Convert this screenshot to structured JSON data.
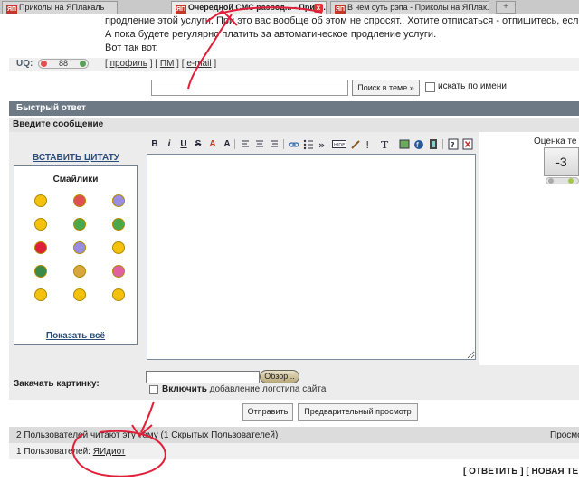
{
  "browser": {
    "tabs": [
      {
        "label": "Приколы на ЯПлакаль",
        "active": false,
        "favicon": "ЯП"
      },
      {
        "label": "Очередной СМС развод... - Прик...",
        "active": true,
        "favicon": "ЯП"
      },
      {
        "label": "В чем суть рэпа - Приколы на ЯПлак...",
        "active": false,
        "favicon": "ЯП"
      }
    ],
    "newtab_label": "+",
    "close_label": "x"
  },
  "post": {
    "lines": [
      "продление этой услуги. При это вас вообще об этом не спросят.. Хотите отписаться - отпишитесь, есл",
      "А пока будете регулярно платить за автоматическое продление услуги.",
      "Вот так вот."
    ],
    "uq_label": "UQ:",
    "uq_value": "88",
    "links": {
      "profile": "профиль",
      "pm": "ПМ",
      "email": "e-mail"
    }
  },
  "search": {
    "value": "",
    "button_label": "Поиск в теме »",
    "checkbox_label": "искать по имени"
  },
  "quick_reply": {
    "header": "Быстрый ответ",
    "message_header": "Введите сообщение",
    "insert_quote": "ВСТАВИТЬ ЦИТАТУ",
    "smilies_title": "Смайлики",
    "show_all": "Показать всё",
    "toolbar_labels": [
      "B",
      "i",
      "U",
      "S",
      "A",
      "A"
    ],
    "rating_label": "Оценка те",
    "rating_value": "-3",
    "upload_label": "Закачать картинку:",
    "browse_label": "Обзор...",
    "logo_label_bold": "Включить",
    "logo_label_rest": " добавление логотипа сайта",
    "submit_label": "Отправить",
    "preview_label": "Предварительный просмотр"
  },
  "readers": {
    "text": "2 Пользователей читают эту тему (1 Скрытых Пользователей)",
    "views_label": "Просмо",
    "users_prefix": "1 Пользователей: ",
    "user_name": "ЯИдиот"
  },
  "bottom": {
    "reply_link": "[ ОТВЕТИТЬ ]",
    "new_topic_link": "[ НОВАЯ ТЕ"
  },
  "colors": {
    "header_bg": "#6d7a86",
    "annotation_red": "#e0203a"
  }
}
